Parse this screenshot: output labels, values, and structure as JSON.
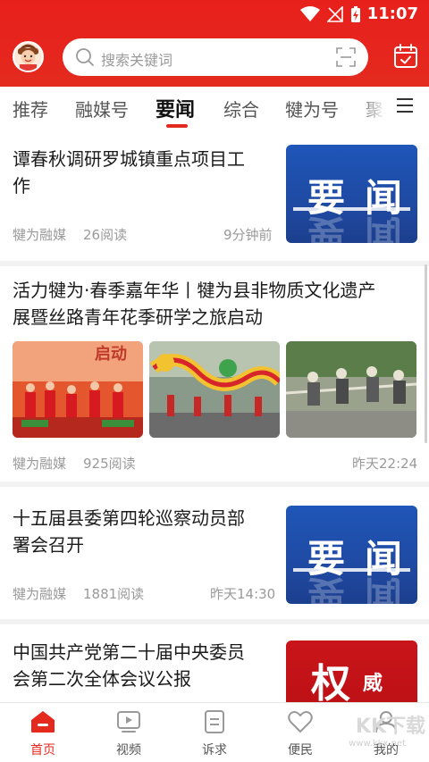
{
  "status": {
    "time": "11:07"
  },
  "search": {
    "placeholder": "搜索关键词"
  },
  "tabs": [
    {
      "label": "推荐"
    },
    {
      "label": "融媒号"
    },
    {
      "label": "要闻"
    },
    {
      "label": "综合"
    },
    {
      "label": "犍为号"
    },
    {
      "label": "聚"
    }
  ],
  "active_tab": "要闻",
  "articles": [
    {
      "title_line1": "谭春秋调研罗城镇重点项目工",
      "title_line2": "作",
      "source": "犍为融媒",
      "reads": "26阅读",
      "time": "9分钟前",
      "thumb_text": [
        "要",
        "闻"
      ]
    },
    {
      "title_line1": "活力犍为·春季嘉年华丨犍为县非物质文化遗产",
      "title_line2": "展暨丝路青年花季研学之旅启动",
      "source": "犍为融媒",
      "reads": "925阅读",
      "time": "昨天22:24",
      "photo1_text": "启动"
    },
    {
      "title_line1": "十五届县委第四轮巡察动员部",
      "title_line2": "署会召开",
      "source": "犍为融媒",
      "reads": "1881阅读",
      "time": "昨天14:30",
      "thumb_text": [
        "要",
        "闻"
      ]
    },
    {
      "title_line1": "中国共产党第二十届中央委员",
      "title_line2": "会第二次全体会议公报",
      "thumb_text": [
        "权",
        "威"
      ]
    }
  ],
  "bottom_nav": [
    {
      "label": "首页",
      "icon": "home-icon"
    },
    {
      "label": "视频",
      "icon": "video-icon"
    },
    {
      "label": "诉求",
      "icon": "appeal-icon"
    },
    {
      "label": "便民",
      "icon": "heart-icon"
    },
    {
      "label": "我的",
      "icon": "profile-icon"
    }
  ],
  "watermark": {
    "main": "KK下载",
    "sub": "www.kkx.net"
  },
  "colors": {
    "brand_red": "#e42a1f",
    "blue_thumb": "#1f56b8"
  }
}
